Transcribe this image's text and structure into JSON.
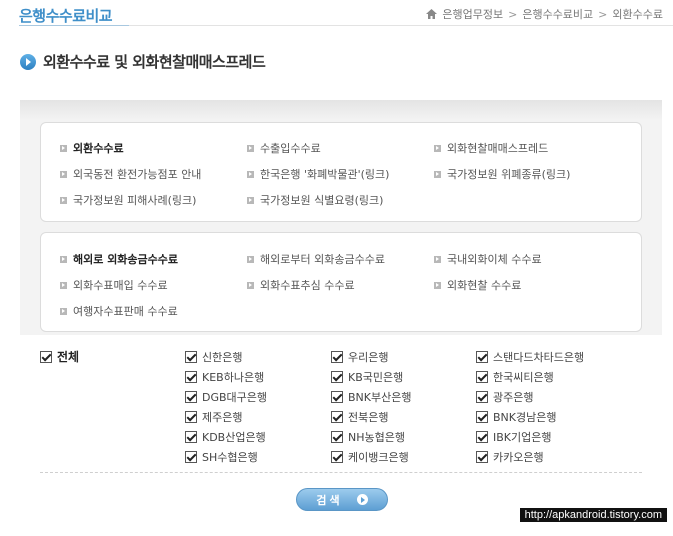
{
  "header": {
    "title": "은행수수료비교",
    "breadcrumb": [
      "은행업무정보",
      "은행수수료비교",
      "외환수수료"
    ]
  },
  "section": {
    "title": "외환수수료 및 외화현찰매매스프레드"
  },
  "menu1": [
    {
      "label": "외환수수료",
      "active": true
    },
    {
      "label": "수출입수수료"
    },
    {
      "label": "외화현찰매매스프레드"
    },
    {
      "label": "외국동전 환전가능점포 안내"
    },
    {
      "label": "한국은행 '화폐박물관'(링크)"
    },
    {
      "label": "국가정보원 위폐종류(링크)"
    },
    {
      "label": "국가정보원 피해사례(링크)"
    },
    {
      "label": "국가정보원 식별요령(링크)"
    }
  ],
  "menu2": [
    {
      "label": "해외로 외화송금수수료",
      "active": true
    },
    {
      "label": "해외로부터 외화송금수수료"
    },
    {
      "label": "국내외화이체 수수료"
    },
    {
      "label": "외화수표매입 수수료"
    },
    {
      "label": "외화수표추심 수수료"
    },
    {
      "label": "외화현찰 수수료"
    },
    {
      "label": "여행자수표판매 수수료"
    }
  ],
  "checkall": {
    "label": "전체",
    "checked": true
  },
  "banks": [
    {
      "label": "신한은행",
      "checked": true
    },
    {
      "label": "우리은행",
      "checked": true
    },
    {
      "label": "스탠다드차타드은행",
      "checked": true
    },
    {
      "label": "KEB하나은행",
      "checked": true
    },
    {
      "label": "KB국민은행",
      "checked": true
    },
    {
      "label": "한국씨티은행",
      "checked": true
    },
    {
      "label": "DGB대구은행",
      "checked": true
    },
    {
      "label": "BNK부산은행",
      "checked": true
    },
    {
      "label": "광주은행",
      "checked": true
    },
    {
      "label": "제주은행",
      "checked": true
    },
    {
      "label": "전북은행",
      "checked": true
    },
    {
      "label": "BNK경남은행",
      "checked": true
    },
    {
      "label": "KDB산업은행",
      "checked": true
    },
    {
      "label": "NH농협은행",
      "checked": true
    },
    {
      "label": "IBK기업은행",
      "checked": true
    },
    {
      "label": "SH수협은행",
      "checked": true
    },
    {
      "label": "케이뱅크은행",
      "checked": true
    },
    {
      "label": "카카오은행",
      "checked": true
    }
  ],
  "search_button": {
    "label": "검색"
  },
  "watermark": "http://apkandroid.tistory.com"
}
